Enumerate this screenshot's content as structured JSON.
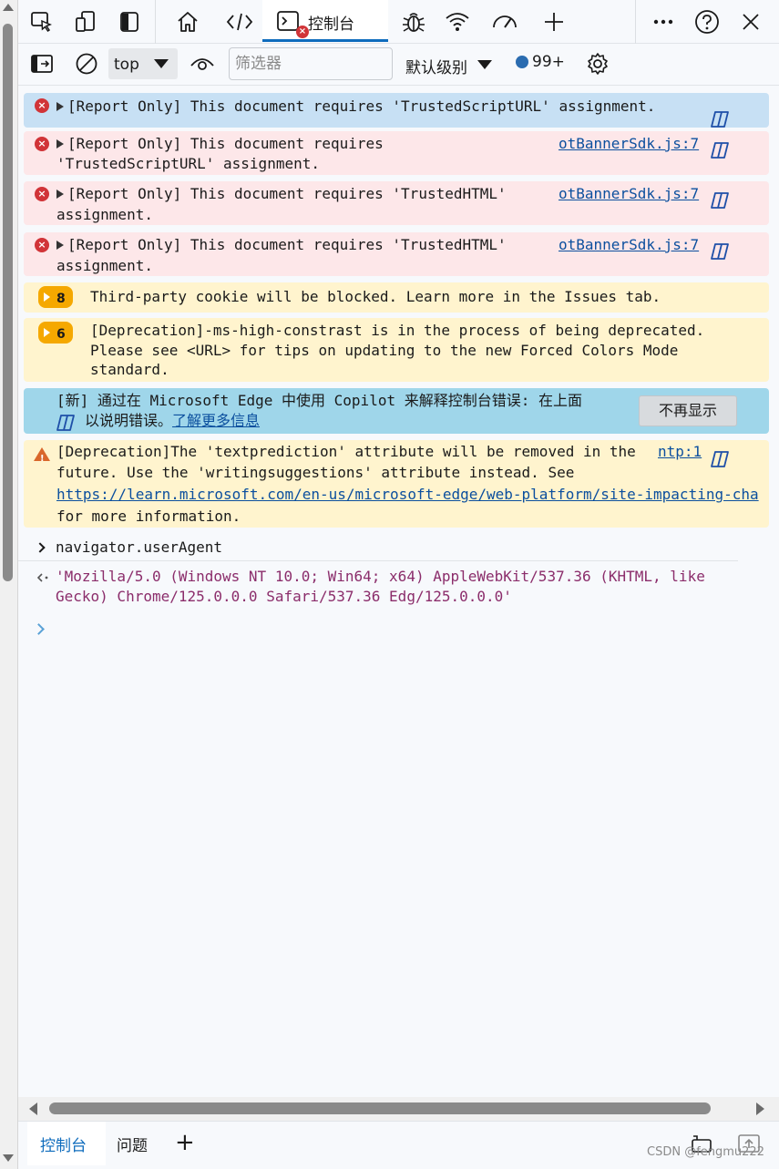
{
  "tabs": {
    "active_label": "控制台",
    "active_error_badge": "×"
  },
  "toolbar": {
    "context_value": "top",
    "filter_placeholder": "筛选器",
    "level_label": "默认级别",
    "message_count": "99+"
  },
  "messages": [
    {
      "type": "error-selected",
      "text": "[Report Only] This document requires 'TrustedScriptURL' assignment.",
      "source": ""
    },
    {
      "type": "error",
      "line1": "[Report Only] This document requires",
      "line2": "'TrustedScriptURL' assignment.",
      "source": "otBannerSdk.js:7"
    },
    {
      "type": "error",
      "line1": "[Report Only] This document requires 'TrustedHTML'",
      "line2": "assignment.",
      "source": "otBannerSdk.js:7"
    },
    {
      "type": "error",
      "line1": "[Report Only] This document requires 'TrustedHTML'",
      "line2": "assignment.",
      "source": "otBannerSdk.js:7"
    }
  ],
  "issues": [
    {
      "count": "8",
      "text": "Third-party cookie will be blocked. Learn more in the Issues tab."
    },
    {
      "count": "6",
      "line1": "[Deprecation]-ms-high-constrast is in the process of being deprecated.",
      "line2": "Please see <URL> for tips on updating to the new Forced Colors Mode",
      "line3": "standard."
    }
  ],
  "copilot_banner": {
    "line1": "[新] 通过在 Microsoft Edge 中使用 Copilot 来解释控制台错误: 在上面",
    "line2_prefix": "以说明错误。",
    "link": "了解更多信息",
    "dismiss_label": "不再显示"
  },
  "deprecation_warning": {
    "line1": "[Deprecation]The 'textprediction' attribute will be removed in the",
    "line2": "future. Use the 'writingsuggestions' attribute instead. See",
    "url": "https://learn.microsoft.com/en-us/microsoft-edge/web-platform/site-impacting-cha",
    "line4": "for more information.",
    "source": "ntp:1"
  },
  "command": "navigator.userAgent",
  "result": {
    "line1": "'Mozilla/5.0 (Windows NT 10.0; Win64; x64) AppleWebKit/537.36 (KHTML, like",
    "line2": "Gecko) Chrome/125.0.0.0 Safari/537.36 Edg/125.0.0.0'"
  },
  "drawer": {
    "console_tab": "控制台",
    "issues_tab": "问题",
    "add_label": "+"
  },
  "watermark": "CSDN @fengmu222",
  "colors": {
    "accent": "#0f6cbd",
    "error": "#d13438",
    "warning_badge": "#f5a800",
    "string": "#8b2d6b"
  }
}
